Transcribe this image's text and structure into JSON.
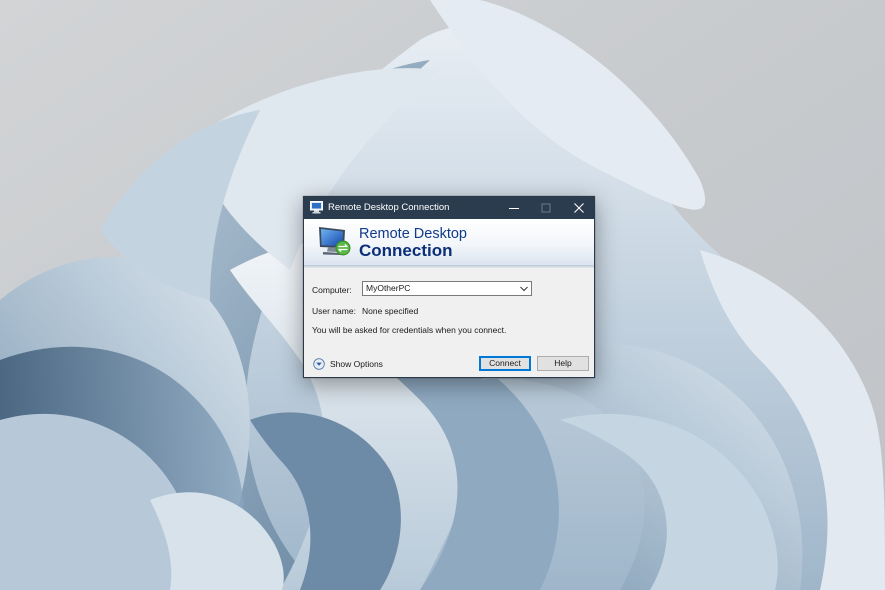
{
  "window": {
    "title": "Remote Desktop Connection",
    "banner_line1": "Remote Desktop",
    "banner_line2": "Connection"
  },
  "form": {
    "computer_label": "Computer:",
    "computer_value": "MyOtherPC",
    "username_label": "User name:",
    "username_value": "None specified",
    "credentials_notice": "You will be asked for credentials when you connect."
  },
  "footer": {
    "show_options_label": "Show Options",
    "connect_label": "Connect",
    "help_label": "Help"
  },
  "icons": {
    "app": "remote-desktop-icon",
    "minimize": "minimize-icon",
    "maximize": "maximize-icon",
    "close": "close-icon",
    "dropdown": "chevron-down-icon",
    "options": "expand-circle-icon"
  },
  "colors": {
    "titlebar": "#2b3c4e",
    "banner_text": "#0d2f78",
    "dialog_bg": "#f0f0f0",
    "default_button_border": "#0078d7"
  }
}
